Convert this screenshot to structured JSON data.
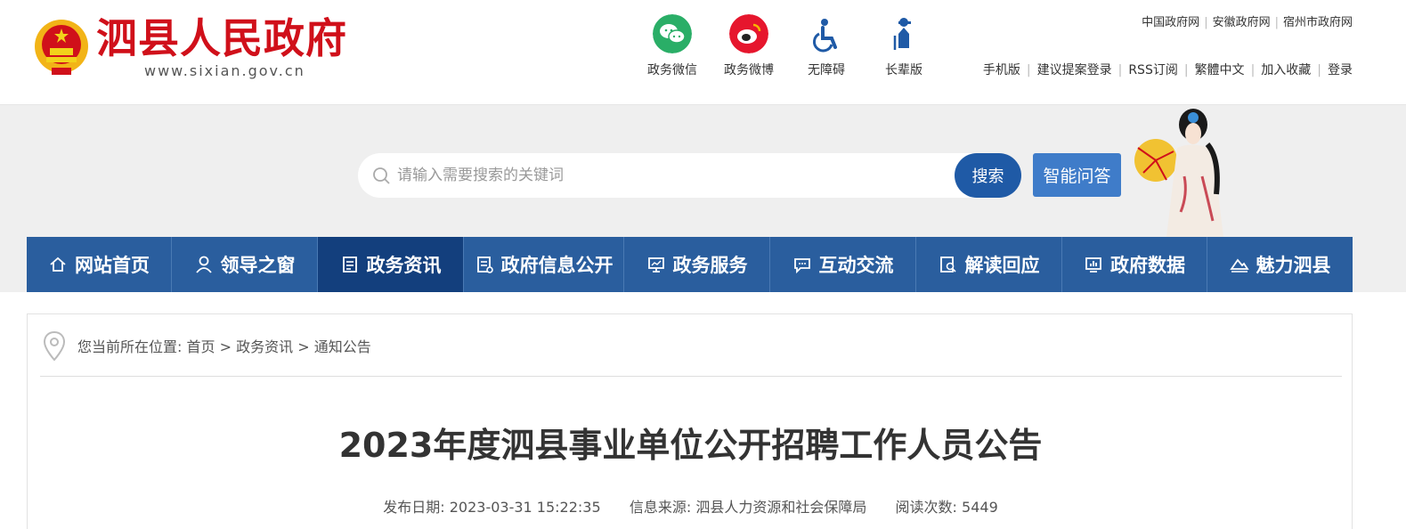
{
  "header": {
    "site_title": "泗县人民政府",
    "site_url": "www.sixian.gov.cn",
    "quick_links": [
      {
        "label": "政务微信",
        "icon": "wechat-icon",
        "color": "#2aae67"
      },
      {
        "label": "政务微博",
        "icon": "weibo-icon",
        "color": "#e6162d"
      },
      {
        "label": "无障碍",
        "icon": "accessibility-icon",
        "color": "#1f5aa6"
      },
      {
        "label": "长辈版",
        "icon": "elder-icon",
        "color": "#1f5aa6"
      }
    ],
    "gov_links": [
      "中国政府网",
      "安徽政府网",
      "宿州市政府网"
    ],
    "util_links": [
      "手机版",
      "建议提案登录",
      "RSS订阅",
      "繁體中文",
      "加入收藏",
      "登录"
    ]
  },
  "search": {
    "placeholder": "请输入需要搜索的关键词",
    "button_label": "搜索",
    "qa_label": "智能问答"
  },
  "nav": {
    "items": [
      {
        "label": "网站首页",
        "icon": "home-icon"
      },
      {
        "label": "领导之窗",
        "icon": "person-icon"
      },
      {
        "label": "政务资讯",
        "icon": "document-icon",
        "active": true
      },
      {
        "label": "政府信息公开",
        "icon": "list-doc-icon"
      },
      {
        "label": "政务服务",
        "icon": "monitor-icon"
      },
      {
        "label": "互动交流",
        "icon": "chat-icon"
      },
      {
        "label": "解读回应",
        "icon": "search-doc-icon"
      },
      {
        "label": "政府数据",
        "icon": "chart-icon"
      },
      {
        "label": "魅力泗县",
        "icon": "landscape-icon"
      }
    ]
  },
  "breadcrumb": {
    "prefix": "您当前所在位置:",
    "items": [
      "首页",
      "政务资讯",
      "通知公告"
    ],
    "separator": ">"
  },
  "article": {
    "title": "2023年度泗县事业单位公开招聘工作人员公告",
    "date_label": "发布日期:",
    "date": "2023-03-31 15:22:35",
    "source_label": "信息来源:",
    "source": "泗县人力资源和社会保障局",
    "reads_label": "阅读次数:",
    "reads": "5449"
  },
  "colors": {
    "brand_red": "#d0101a",
    "nav_blue": "#2a5e9e",
    "nav_active": "#133f7d",
    "search_blue": "#1f5aa6"
  }
}
